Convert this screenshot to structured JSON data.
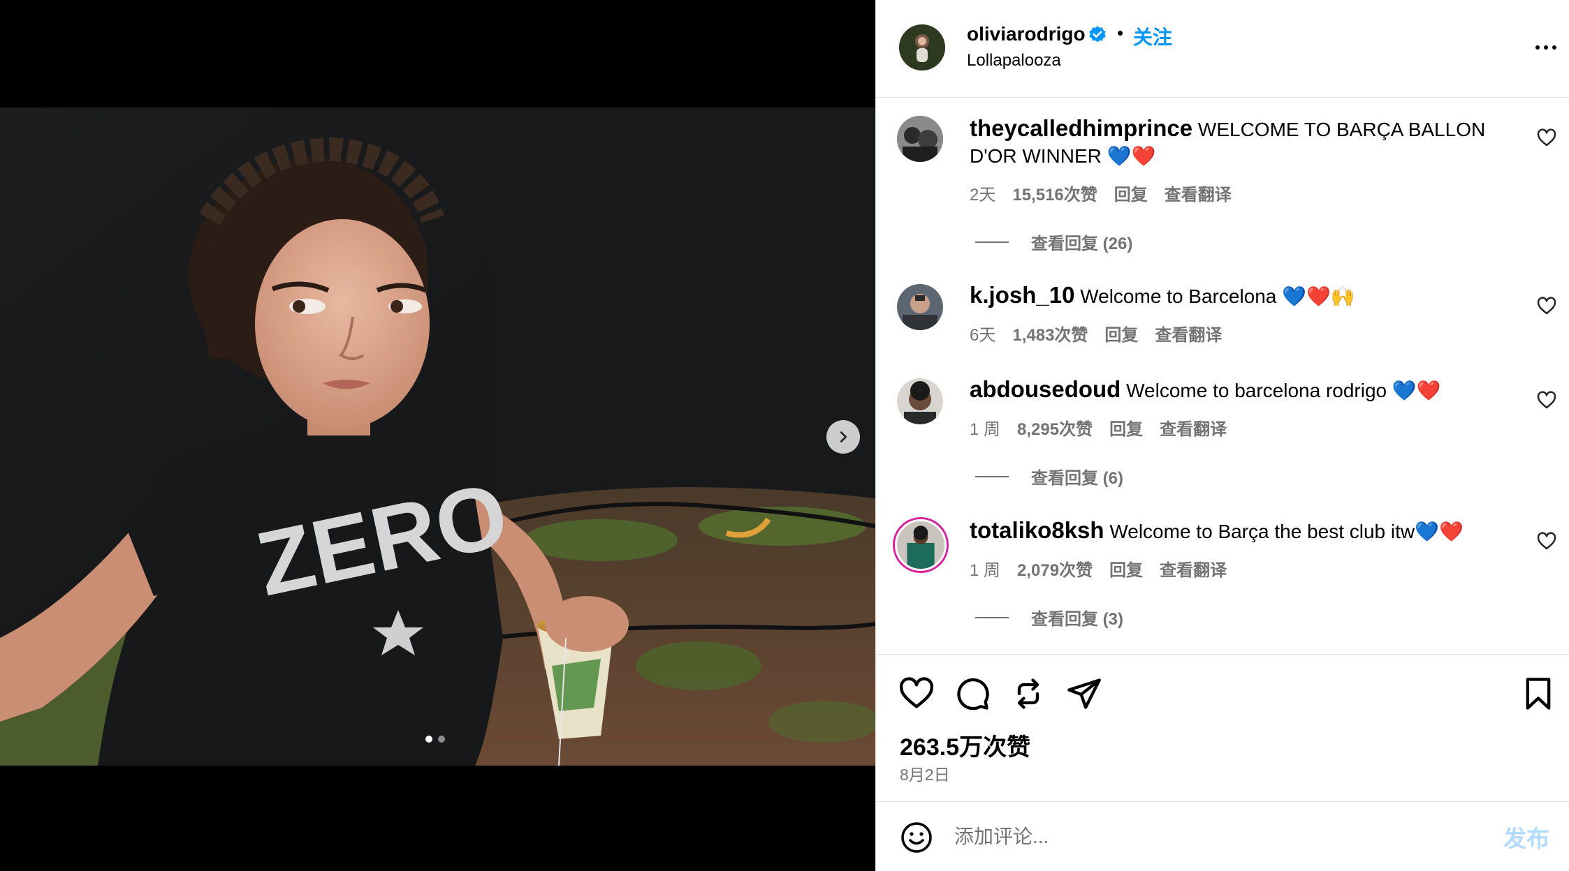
{
  "post": {
    "username": "oliviarodrigo",
    "separator": "•",
    "follow_label": "关注",
    "location": "Lollapalooza",
    "shirt_text": "ZERO"
  },
  "comments": [
    {
      "username": "theycalledhimprince",
      "text": "WELCOME TO BARÇA BALLON D'OR WINNER 💙❤️",
      "age": "2天",
      "likes": "15,516次赞",
      "reply": "回复",
      "translate": "查看翻译",
      "view_replies": "查看回复 (26)"
    },
    {
      "username": "k.josh_10",
      "text": "Welcome to Barcelona 💙❤️🙌",
      "age": "6天",
      "likes": "1,483次赞",
      "reply": "回复",
      "translate": "查看翻译",
      "view_replies": ""
    },
    {
      "username": "abdousedoud",
      "text": "Welcome to barcelona rodrigo 💙❤️",
      "age": "1 周",
      "likes": "8,295次赞",
      "reply": "回复",
      "translate": "查看翻译",
      "view_replies": "查看回复 (6)"
    },
    {
      "username": "totaliko8ksh",
      "text": "Welcome to Barça the best club itw💙❤️",
      "age": "1 周",
      "likes": "2,079次赞",
      "reply": "回复",
      "translate": "查看翻译",
      "view_replies": "查看回复 (3)"
    }
  ],
  "stats": {
    "likes": "263.5万次赞",
    "date": "8月2日"
  },
  "composer": {
    "placeholder": "添加评论...",
    "post_label": "发布"
  },
  "carousel": {
    "current": 1,
    "total": 2
  },
  "icons": {
    "more": "more-options-icon",
    "verified": "verified-badge-icon",
    "like": "heart-icon",
    "comment": "comment-icon",
    "repost": "repost-icon",
    "share": "share-icon",
    "save": "bookmark-icon",
    "emoji": "emoji-icon",
    "next": "chevron-right-icon"
  },
  "colors": {
    "link_blue": "#0095f6",
    "muted": "#737373",
    "post_disabled": "#b3dbff"
  }
}
